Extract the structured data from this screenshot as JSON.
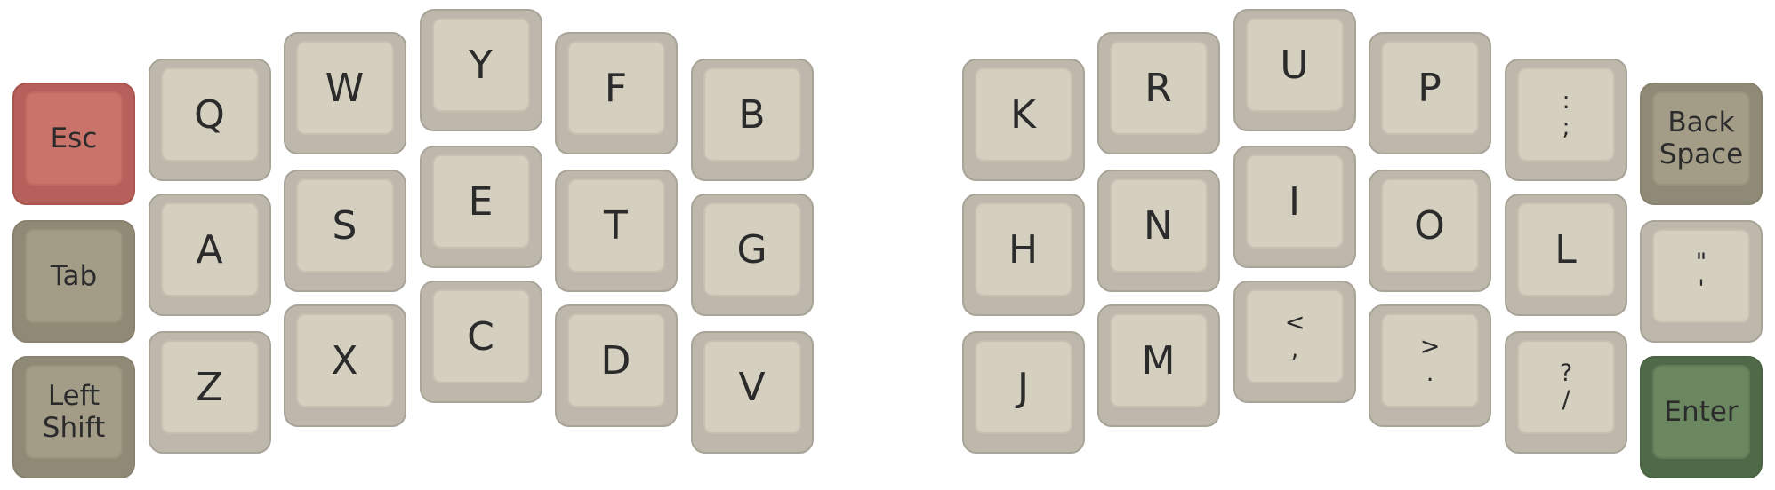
{
  "keyboard": {
    "left_mods": {
      "esc": "Esc",
      "tab": "Tab",
      "shift": [
        "Left",
        "Shift"
      ]
    },
    "left": {
      "row1": [
        "Q",
        "W",
        "Y",
        "F",
        "B"
      ],
      "row2": [
        "A",
        "S",
        "E",
        "T",
        "G"
      ],
      "row3": [
        "Z",
        "X",
        "C",
        "D",
        "V"
      ]
    },
    "right": {
      "row1": [
        "K",
        "R",
        "U",
        "P"
      ],
      "row2": [
        "H",
        "N",
        "I",
        "O",
        "L"
      ],
      "row3": [
        "J",
        "M"
      ],
      "colon_key": [
        ":",
        ";"
      ],
      "comma_key": [
        "<",
        ","
      ],
      "period_key": [
        ">",
        "."
      ],
      "slash_key": [
        "?",
        "/"
      ]
    },
    "right_mods": {
      "backspace": [
        "Back",
        "Space"
      ],
      "quote_key": [
        "\"",
        "'"
      ],
      "enter": "Enter"
    },
    "colors": {
      "esc": "#c9736a",
      "modifier": "#a39d88",
      "backspace": "#a39d88",
      "enter": "#6a8760",
      "alpha": "#d4cfbf"
    }
  }
}
